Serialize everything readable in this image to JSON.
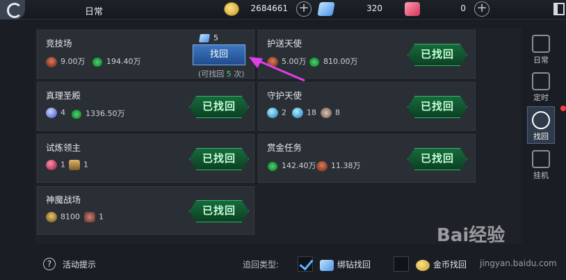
{
  "header": {
    "title": "日常"
  },
  "resources": [
    {
      "icon": "gold-coin-icon",
      "value": "2684661"
    },
    {
      "icon": "blue-diamond-icon",
      "value": "320"
    },
    {
      "icon": "red-gem-icon",
      "value": "0"
    }
  ],
  "cards": [
    {
      "name": "竞技场",
      "items": [
        {
          "icon": "resource-icon",
          "text": "9.00万"
        },
        {
          "icon": "gold-icon",
          "text": "194.40万"
        }
      ],
      "diamond_cost": "5",
      "button": "找回",
      "remaining_prefix": "(可找回",
      "remaining_count": "5",
      "remaining_suffix": "次)"
    },
    {
      "name": "护送天使",
      "items": [
        {
          "icon": "resource-icon",
          "text": "5.00万"
        },
        {
          "icon": "gold-icon",
          "text": "810.00万"
        }
      ],
      "status": "已找回"
    },
    {
      "name": "真理圣殿",
      "items": [
        {
          "icon": "orb-icon",
          "text": "4"
        },
        {
          "icon": "gold-icon",
          "text": "1336.50万"
        }
      ],
      "status": "已找回"
    },
    {
      "name": "守护天使",
      "items": [
        {
          "icon": "crystal-icon",
          "text": "2"
        },
        {
          "icon": "gem-icon",
          "text": "18"
        },
        {
          "icon": "gear-icon",
          "text": "8"
        }
      ],
      "status": "已找回"
    },
    {
      "name": "试炼领主",
      "items": [
        {
          "icon": "red-orb-icon",
          "text": "1"
        },
        {
          "icon": "chest-icon",
          "text": "1"
        }
      ],
      "status": "已找回"
    },
    {
      "name": "赏金任务",
      "items": [
        {
          "icon": "gold-icon",
          "text": "142.40万"
        },
        {
          "icon": "resource-icon",
          "text": "11.38万"
        }
      ],
      "status": "已找回"
    },
    {
      "name": "神魔战场",
      "items": [
        {
          "icon": "helmet-icon",
          "text": "8100"
        },
        {
          "icon": "bag-icon",
          "text": "1"
        }
      ],
      "status": "已找回"
    }
  ],
  "sidebar": {
    "tabs": [
      {
        "label": "日常",
        "icon": "daily-icon"
      },
      {
        "label": "定时",
        "icon": "timer-icon"
      },
      {
        "label": "找回",
        "icon": "retrieve-icon",
        "active": true
      },
      {
        "label": "挂机",
        "icon": "idle-icon"
      }
    ]
  },
  "footer": {
    "tip": "活动提示",
    "retrieve_type_label": "追回类型:",
    "options": [
      {
        "label": "绑钻找回",
        "checked": true
      },
      {
        "label": "金币找回",
        "checked": false
      }
    ]
  },
  "watermark": {
    "text": "Bai经验",
    "url": "jingyan.baidu.com"
  },
  "colors": {
    "accent_green": "#2fb86a",
    "button_blue": "#3e77c2",
    "annotation_arrow": "#e040e8"
  }
}
